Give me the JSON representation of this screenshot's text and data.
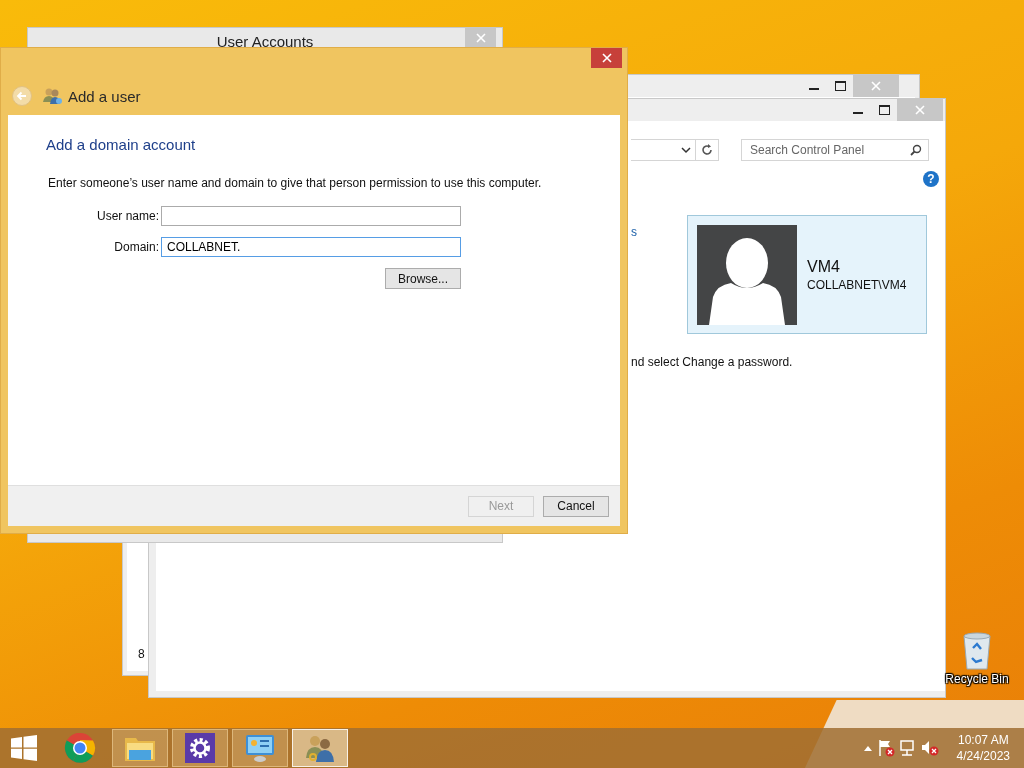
{
  "desktop_icons": [
    {
      "label": "Recycle Bin"
    }
  ],
  "back_window": {
    "partial_text": "8"
  },
  "control_panel": {
    "search": {
      "placeholder": "Search Control Panel"
    },
    "help_icon": "?",
    "link_fragment": "s",
    "account": {
      "name": "VM4",
      "domain": "COLLABNET\\VM4"
    },
    "instruction_fragment": "nd select Change a password."
  },
  "user_accounts_window": {
    "title": "User Accounts"
  },
  "dialog": {
    "header": "Add a user",
    "heading": "Add a domain account",
    "description": "Enter someone’s user name and domain to give that person permission to use this computer.",
    "fields": [
      {
        "label": "User name:",
        "focused": false
      },
      {
        "label": "Domain:",
        "value": "COLLABNET.",
        "focused": true
      }
    ],
    "browse_button": {
      "label": "Browse...",
      "disabled": false
    },
    "footer_buttons": [
      {
        "label": "Next",
        "disabled": true
      },
      {
        "label": "Cancel",
        "disabled": false
      }
    ]
  },
  "taskbar": {
    "apps": [
      {
        "kind": "chrome",
        "active": false
      },
      {
        "kind": "explorer",
        "active": false
      },
      {
        "kind": "settings",
        "active": false
      },
      {
        "kind": "control_panel",
        "active": false
      },
      {
        "kind": "users",
        "active": true
      }
    ],
    "clock": {
      "time": "10:07 AM",
      "date": "4/24/2023"
    }
  }
}
